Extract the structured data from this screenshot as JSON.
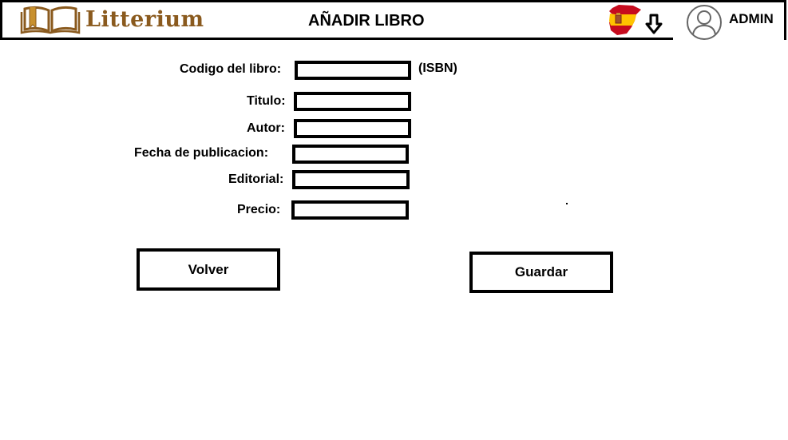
{
  "header": {
    "brand": "Litterium",
    "title": "AÑADIR LIBRO",
    "user": "ADMIN"
  },
  "form": {
    "isbn_label": "Codigo del libro:",
    "isbn_suffix": "(ISBN)",
    "isbn_value": "",
    "title_label": "Titulo:",
    "title_value": "",
    "author_label": "Autor:",
    "author_value": "",
    "date_label": "Fecha de publicacion:",
    "date_value": "",
    "publisher_label": "Editorial:",
    "publisher_value": "",
    "price_label": "Precio:",
    "price_value": ""
  },
  "actions": {
    "back_label": "Volver",
    "save_label": "Guardar"
  },
  "icons": {
    "logo": "open-book-icon",
    "language": "spain-flag-icon",
    "language_dropdown": "arrow-down-icon",
    "user": "user-avatar-icon"
  },
  "colors": {
    "brand": "#8a5a1e",
    "flag_red": "#c60b1e",
    "flag_yellow": "#ffc400"
  }
}
